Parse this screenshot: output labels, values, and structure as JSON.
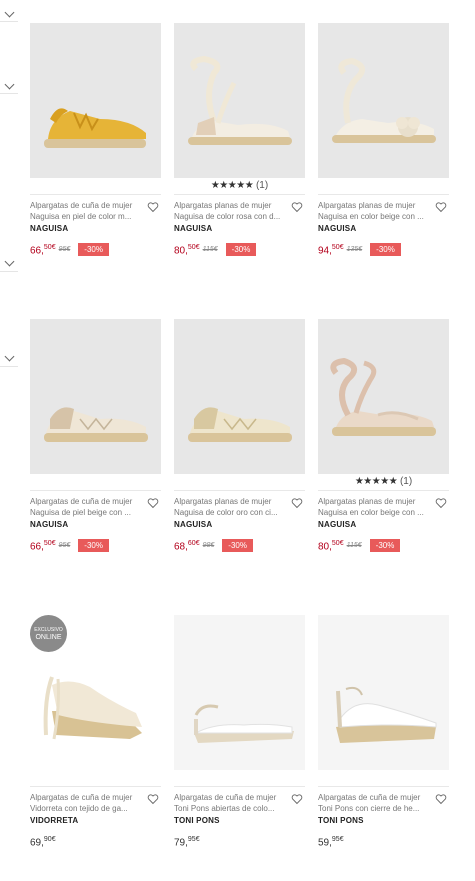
{
  "products": [
    {
      "title1": "Alpargatas de cuña de mujer",
      "title2": "Naguisa en piel de color m...",
      "brand": "NAGUISA",
      "price_int": "66,",
      "price_dec": "50€",
      "old": "95€",
      "discount": "-30%",
      "rating": ""
    },
    {
      "title1": "Alpargatas planas de mujer",
      "title2": "Naguisa de color rosa con d...",
      "brand": "NAGUISA",
      "price_int": "80,",
      "price_dec": "50€",
      "old": "115€",
      "discount": "-30%",
      "rating": "(1)"
    },
    {
      "title1": "Alpargatas planas de mujer",
      "title2": "Naguisa en color beige con ...",
      "brand": "NAGUISA",
      "price_int": "94,",
      "price_dec": "50€",
      "old": "135€",
      "discount": "-30%",
      "rating": ""
    },
    {
      "title1": "Alpargatas de cuña de mujer",
      "title2": "Naguisa de piel beige con ...",
      "brand": "NAGUISA",
      "price_int": "66,",
      "price_dec": "50€",
      "old": "95€",
      "discount": "-30%",
      "rating": ""
    },
    {
      "title1": "Alpargatas planas de mujer",
      "title2": "Naguisa de color oro con ci...",
      "brand": "NAGUISA",
      "price_int": "68,",
      "price_dec": "60€",
      "old": "98€",
      "discount": "-30%",
      "rating": ""
    },
    {
      "title1": "Alpargatas planas de mujer",
      "title2": "Naguisa en color beige con ...",
      "brand": "NAGUISA",
      "price_int": "80,",
      "price_dec": "50€",
      "old": "115€",
      "discount": "-30%",
      "rating": "(1)"
    },
    {
      "title1": "Alpargatas de cuña de mujer",
      "title2": "Vidorreta con tejido de ga...",
      "brand": "VIDORRETA",
      "price_int": "69,",
      "price_dec": "90€",
      "old": "",
      "discount": "",
      "rating": "",
      "badge_l1": "EXCLUSIVO",
      "badge_l2": "ONLINE"
    },
    {
      "title1": "Alpargatas de cuña de mujer",
      "title2": "Toni Pons abiertas de colo...",
      "brand": "TONI PONS",
      "price_int": "79,",
      "price_dec": "95€",
      "old": "",
      "discount": "",
      "rating": ""
    },
    {
      "title1": "Alpargatas de cuña de mujer",
      "title2": "Toni Pons con cierre de he...",
      "brand": "TONI PONS",
      "price_int": "59,",
      "price_dec": "95€",
      "old": "",
      "discount": "",
      "rating": ""
    }
  ],
  "rating_stars": "★★★★★",
  "icons": {
    "heart": "heart-icon",
    "chevron": "chevron-down-icon"
  },
  "colors": {
    "sale_price": "#b3001b",
    "discount_badge": "#e85a5a"
  }
}
